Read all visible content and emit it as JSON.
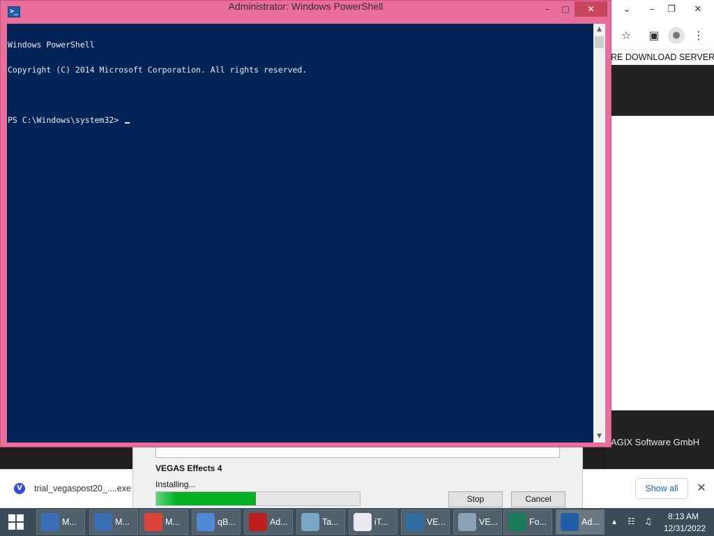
{
  "powershell": {
    "title": "Administrator: Windows PowerShell",
    "console_lines": [
      "Windows PowerShell",
      "Copyright (C) 2014 Microsoft Corporation. All rights reserved.",
      "",
      "PS C:\\Windows\\system32> "
    ],
    "window_controls": {
      "minimize": "–",
      "maximize": "□",
      "close": "✕"
    },
    "scroll": {
      "up": "▲",
      "down": "▼"
    }
  },
  "chrome": {
    "window_controls": {
      "tabs": "⌄",
      "minimize": "–",
      "restore": "❐",
      "close": "✕"
    },
    "toolbar_icons": [
      "star-icon",
      "sidebar-icon",
      "profile-icon",
      "menu-dots-icon"
    ],
    "toolbar_glyphs": {
      "star": "☆",
      "sidebar": "▣",
      "profile": "●",
      "menu": "⋮"
    },
    "nav_text": "RE DOWNLOAD SERVER",
    "footer_text": "AGIX Software GmbH"
  },
  "installer": {
    "product": "VEGAS Effects 4",
    "status": "Installing...",
    "progress": 0.49,
    "stop_label": "Stop",
    "cancel_label": "Cancel"
  },
  "download_bar": {
    "icon_letter": "V",
    "filename": "trial_vegaspost20_....exe",
    "show_all": "Show all",
    "close": "✕"
  },
  "taskbar": {
    "items": [
      {
        "label": "M...",
        "icon": "computer-icon",
        "color": "#3b6fb5"
      },
      {
        "label": "M...",
        "icon": "computer-icon",
        "color": "#3b6fb5"
      },
      {
        "label": "M...",
        "icon": "chrome-icon",
        "color": "#db4437"
      },
      {
        "label": "qB...",
        "icon": "qbittorrent-icon",
        "color": "#4f8ad6"
      },
      {
        "label": "Ad...",
        "icon": "filezilla-icon",
        "color": "#bf1e1e"
      },
      {
        "label": "Ta...",
        "icon": "task-manager-icon",
        "color": "#7aa6c8"
      },
      {
        "label": "iT...",
        "icon": "itunes-icon",
        "color": "#e9e9ef"
      },
      {
        "label": "VE...",
        "icon": "vegas-icon",
        "color": "#2f6ea5"
      },
      {
        "label": "VE...",
        "icon": "installer-icon",
        "color": "#8aa0b4"
      },
      {
        "label": "Fo...",
        "icon": "food-icon",
        "color": "#1c7a5a"
      },
      {
        "label": "Ad...",
        "icon": "powershell-icon",
        "color": "#1f5fa8"
      }
    ],
    "time": "8:13 AM",
    "date": "12/31/2022",
    "tray_glyphs": {
      "chevron": "▴",
      "network": "☷",
      "volume": "♫"
    }
  }
}
